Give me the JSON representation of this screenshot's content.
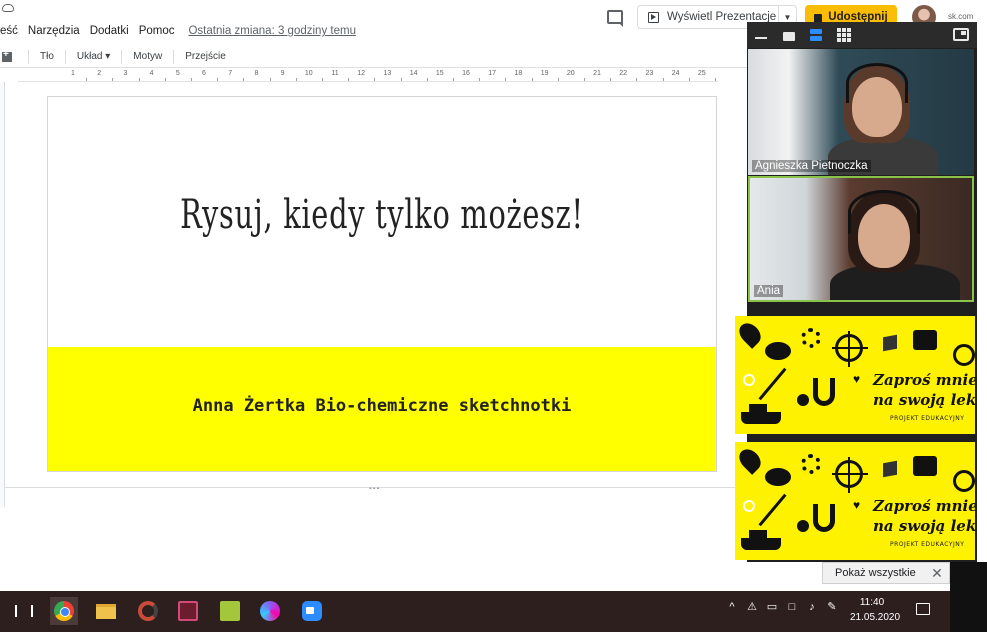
{
  "menubar": {
    "items": [
      "eść",
      "Narzędzia",
      "Dodatki",
      "Pomoc"
    ],
    "last_edit": "Ostatnia zmiana: 3 godziny temu"
  },
  "header": {
    "present_label": "Wyświetl Prezentacje",
    "share_label": "Udostępnij",
    "url_fragment": "sk.com"
  },
  "toolbar": {
    "items": [
      "Tło",
      "Układ",
      "Motyw",
      "Przejście"
    ]
  },
  "ruler": {
    "labels": [
      "1",
      "2",
      "3",
      "4",
      "5",
      "6",
      "7",
      "8",
      "9",
      "10",
      "11",
      "12",
      "13",
      "14",
      "15",
      "16",
      "17",
      "18",
      "19",
      "20",
      "21",
      "22",
      "23",
      "24",
      "25"
    ]
  },
  "slide": {
    "title": "Rysuj, kiedy tylko możesz!",
    "subtitle": "Anna Żertka Bio-chemiczne sketchnotki",
    "band_color": "#ffff00"
  },
  "video_call": {
    "participants": [
      {
        "name": "Agnieszka Pietnoczka"
      },
      {
        "name": "Ania"
      }
    ],
    "active_speaker_border": "#8bc34a",
    "graphic": {
      "line1": "Zaproś mnie",
      "line2": "na swoją lekcję",
      "small": "PROJEKT EDUKACYJNY"
    }
  },
  "notification": {
    "show_all_label": "Pokaż wszystkie"
  },
  "taskbar": {
    "time": "11:40",
    "date": "21.05.2020"
  },
  "colors": {
    "accent_yellow": "#fbbc04",
    "zoom_blue": "#2d8cff",
    "taskbar_bg": "#2e1f1f"
  }
}
